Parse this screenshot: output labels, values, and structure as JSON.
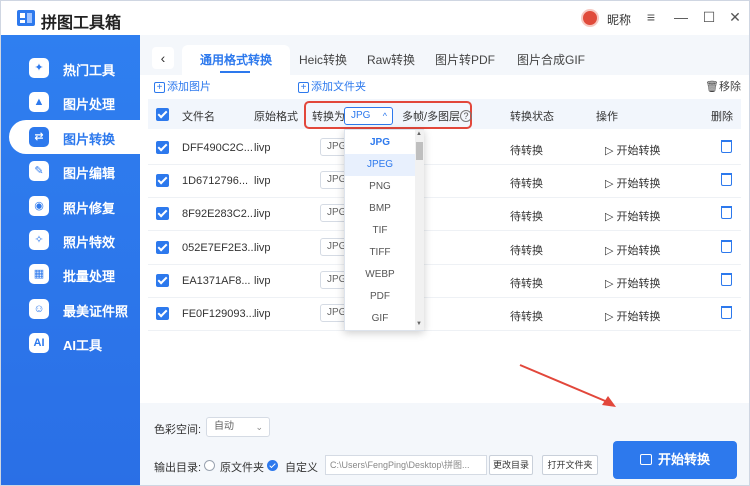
{
  "app": {
    "title": "拼图工具箱",
    "nickname": "昵称"
  },
  "window": {
    "menu_icon": "≡",
    "minimize_icon": "—",
    "maximize_icon": "☐",
    "close_icon": "✕"
  },
  "sidebar": {
    "items": [
      {
        "label": "热门工具",
        "icon": "tools-icon",
        "glyph": "✦"
      },
      {
        "label": "图片处理",
        "icon": "image-edit-icon",
        "glyph": "▲"
      },
      {
        "label": "图片转换",
        "icon": "image-convert-icon",
        "glyph": "⇄",
        "active": true
      },
      {
        "label": "图片编辑",
        "icon": "image-pencil-icon",
        "glyph": "✎"
      },
      {
        "label": "照片修复",
        "icon": "camera-icon",
        "glyph": "◉"
      },
      {
        "label": "照片特效",
        "icon": "camera-effect-icon",
        "glyph": "✧"
      },
      {
        "label": "批量处理",
        "icon": "batch-icon",
        "glyph": "▦"
      },
      {
        "label": "最美证件照",
        "icon": "id-photo-icon",
        "glyph": "☺"
      },
      {
        "label": "AI工具",
        "icon": "ai-icon",
        "glyph": "AI"
      }
    ]
  },
  "tabs": [
    "通用格式转换",
    "Heic转换",
    "Raw转换",
    "图片转PDF",
    "图片合成GIF"
  ],
  "toolbar": {
    "add_image": "添加图片",
    "add_folder": "添加文件夹",
    "clear_all": "移除"
  },
  "table": {
    "headers": {
      "filename": "文件名",
      "orig_format": "原始格式",
      "convert_to": "转换为",
      "multi": "多帧/多图层",
      "status": "转换状态",
      "action": "操作",
      "delete": "删除"
    },
    "target_format": "JPG",
    "help_glyph": "?",
    "rows": [
      {
        "filename": "DFF490C2C...",
        "format": "livp",
        "target": "JPG",
        "status": "待转换",
        "action": "开始转换"
      },
      {
        "filename": "1D6712796...",
        "format": "livp",
        "target": "JPG",
        "status": "待转换",
        "action": "开始转换"
      },
      {
        "filename": "8F92E283C2...",
        "format": "livp",
        "target": "JPG",
        "status": "待转换",
        "action": "开始转换"
      },
      {
        "filename": "052E7EF2E3...",
        "format": "livp",
        "target": "JPG",
        "status": "待转换",
        "action": "开始转换"
      },
      {
        "filename": "EA1371AF8...",
        "format": "livp",
        "target": "JPG",
        "status": "待转换",
        "action": "开始转换"
      },
      {
        "filename": "FE0F129093...",
        "format": "livp",
        "target": "JPG",
        "status": "待转换",
        "action": "开始转换"
      }
    ]
  },
  "dropdown": {
    "options": [
      "JPG",
      "JPEG",
      "PNG",
      "BMP",
      "TIF",
      "TIFF",
      "WEBP",
      "PDF",
      "GIF"
    ],
    "selected": "JPG",
    "hovered": "JPEG"
  },
  "bottom": {
    "color_space_label": "色彩空间:",
    "color_space_value": "自动",
    "output_label": "输出目录:",
    "source_folder": "原文件夹",
    "custom": "自定义",
    "path": "C:\\Users\\FengPing\\Desktop\\拼图...",
    "change_dir": "更改目录",
    "open_folder": "打开文件夹",
    "start_button": "开始转换"
  },
  "colors": {
    "accent": "#2d79ed",
    "highlight": "#e2473b"
  }
}
